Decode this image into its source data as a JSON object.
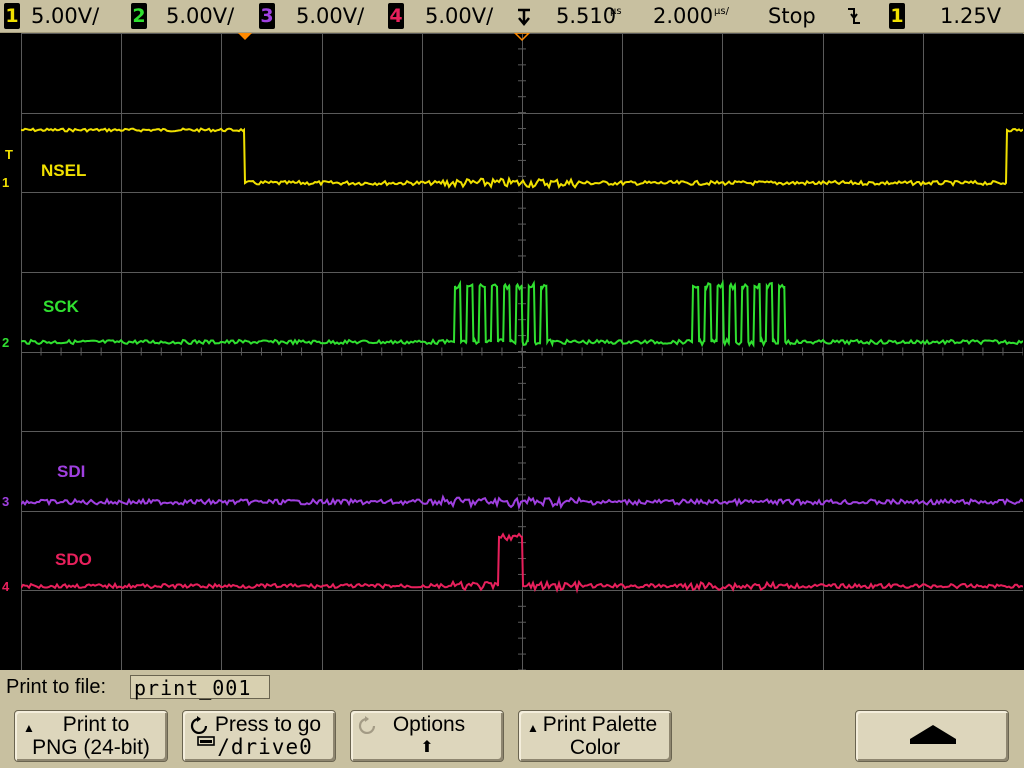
{
  "topbar": {
    "ch1": {
      "num": "1",
      "scale": "5.00V/",
      "color": "#f0e000"
    },
    "ch2": {
      "num": "2",
      "scale": "5.00V/",
      "color": "#30e030"
    },
    "ch3": {
      "num": "3",
      "scale": "5.00V/",
      "color": "#a040e0"
    },
    "ch4": {
      "num": "4",
      "scale": "5.00V/",
      "color": "#e8205c"
    },
    "trigger_position": "5.510",
    "trigger_position_unit": "µs",
    "timebase": "2.000",
    "timebase_unit": "µs/",
    "run_state": "Stop",
    "trigger_edge_icon": "falling-edge-icon",
    "trigger_source": "1",
    "trigger_level": "1.25V"
  },
  "screen": {
    "labels": {
      "nsel": "NSEL",
      "sck": "SCK",
      "sdi": "SDI",
      "sdo": "SDO"
    },
    "ground_markers": {
      "ch1": "1",
      "ch2": "2",
      "ch3": "3",
      "ch4": "4",
      "trigger_level_marker": "T"
    },
    "colors": {
      "nsel": "#f0e000",
      "sck": "#30e030",
      "sdi": "#a040e0",
      "sdo": "#e8205c",
      "grid": "#5a5a5a",
      "marker": "#ff8a00"
    }
  },
  "bottombar": {
    "file_label": "Print to file:",
    "file_value": "print_001",
    "softkeys": [
      {
        "line1": "Print to",
        "line2": "PNG (24-bit)"
      },
      {
        "line1": "Press to go",
        "line2": "/drive0"
      },
      {
        "line1": "Options",
        "line2": ""
      },
      {
        "line1": "Print Palette",
        "line2": "Color"
      },
      {
        "line1": "",
        "line2": ""
      }
    ]
  }
}
